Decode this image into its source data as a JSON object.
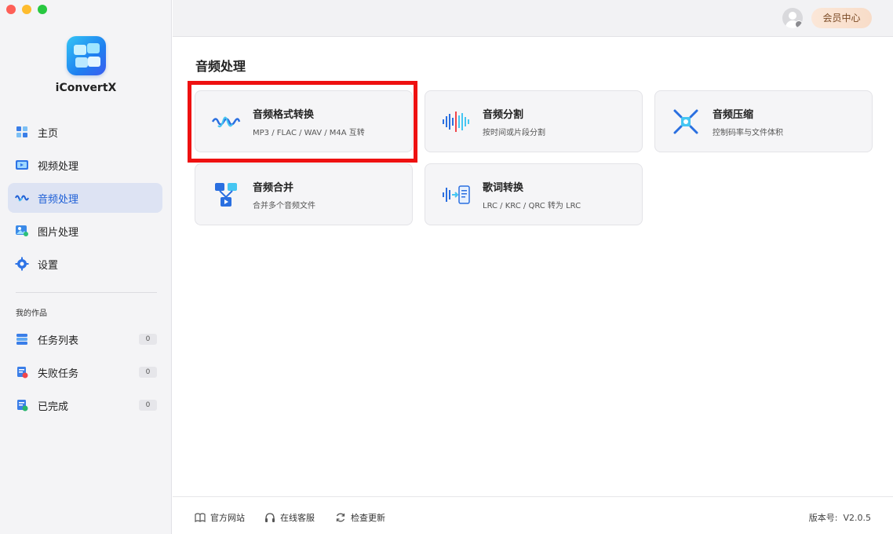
{
  "app": {
    "name": "iConvertX"
  },
  "colors": {
    "accent": "#1d5fd6",
    "highlight": "#ee1111",
    "vip_bg": "#f8dcc8"
  },
  "sidebar": {
    "nav": [
      {
        "label": "主页",
        "icon": "home-grid-icon"
      },
      {
        "label": "视频处理",
        "icon": "video-icon"
      },
      {
        "label": "音频处理",
        "icon": "audio-wave-icon",
        "active": true
      },
      {
        "label": "图片处理",
        "icon": "image-icon"
      },
      {
        "label": "设置",
        "icon": "gear-icon"
      }
    ],
    "works_label": "我的作品",
    "works": [
      {
        "label": "任务列表",
        "count": "0",
        "icon": "task-stack-icon"
      },
      {
        "label": "失败任务",
        "count": "0",
        "icon": "failed-task-icon"
      },
      {
        "label": "已完成",
        "count": "0",
        "icon": "completed-task-icon"
      }
    ]
  },
  "header": {
    "vip_label": "会员中心"
  },
  "main": {
    "title": "音频处理",
    "cards": [
      {
        "title": "音频格式转换",
        "sub": "MP3 / FLAC / WAV / M4A 互转",
        "icon": "audio-wave-icon"
      },
      {
        "title": "音频分割",
        "sub": "按时间或片段分割",
        "icon": "audio-split-icon"
      },
      {
        "title": "音频压缩",
        "sub": "控制码率与文件体积",
        "icon": "compress-arrows-icon"
      },
      {
        "title": "音频合并",
        "sub": "合并多个音频文件",
        "icon": "merge-files-icon"
      },
      {
        "title": "歌词转换",
        "sub": "LRC / KRC / QRC 转为 LRC",
        "icon": "lyrics-convert-icon"
      }
    ]
  },
  "footer": {
    "links": [
      {
        "label": "官方网站",
        "icon": "book-icon"
      },
      {
        "label": "在线客服",
        "icon": "headset-icon"
      },
      {
        "label": "检查更新",
        "icon": "refresh-icon"
      }
    ],
    "version_label": "版本号:",
    "version": "V2.0.5"
  }
}
